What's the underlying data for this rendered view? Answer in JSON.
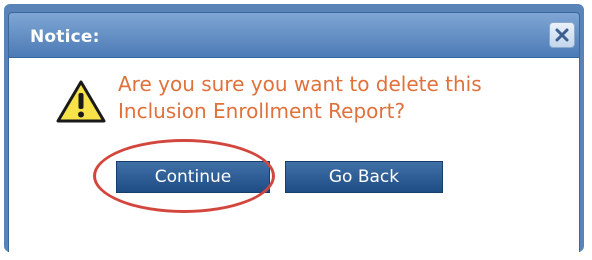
{
  "dialog": {
    "title": "Notice:",
    "message": "Are you sure you want to delete this Inclusion Enrollment Report?",
    "icons": {
      "warning": "warning-triangle-icon",
      "close": "close-icon"
    }
  },
  "buttons": {
    "continue_label": "Continue",
    "go_back_label": "Go Back"
  },
  "colors": {
    "titlebar": "#4c7bb6",
    "message_text": "#e0713a",
    "button": "#2a5b93",
    "highlight": "#d2463e"
  }
}
